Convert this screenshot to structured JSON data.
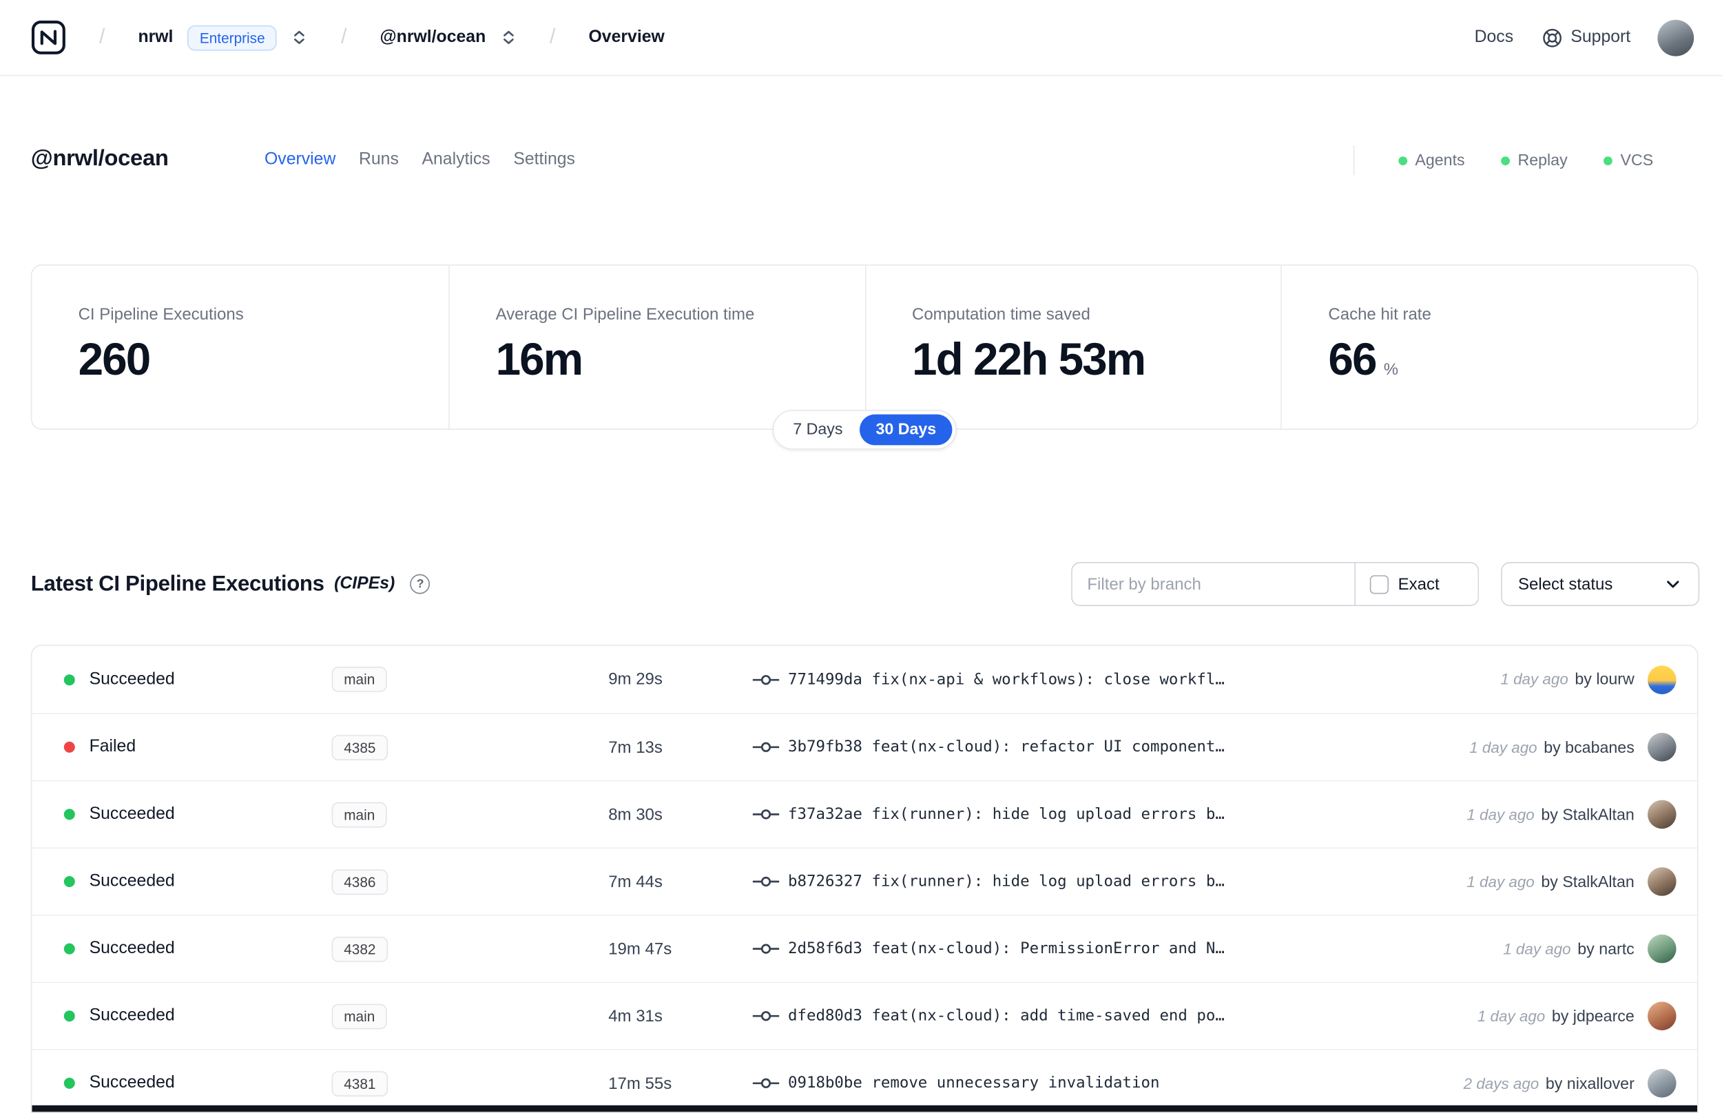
{
  "colors": {
    "accent": "#2563eb",
    "success": "#22c55e",
    "failed": "#ef4444",
    "indicator_green": "#4ade80"
  },
  "icons": {
    "help": "?"
  },
  "navbar": {
    "separator": "/",
    "org": "nrwl",
    "org_badge": "Enterprise",
    "workspace": "@nrwl/ocean",
    "page": "Overview",
    "docs": "Docs",
    "support": "Support"
  },
  "workspace": {
    "title": "@nrwl/ocean",
    "tabs": [
      "Overview",
      "Runs",
      "Analytics",
      "Settings"
    ],
    "indicators": [
      "Agents",
      "Replay",
      "VCS"
    ]
  },
  "stats": {
    "cards": [
      {
        "label": "CI Pipeline Executions",
        "value": "260"
      },
      {
        "label": "Average CI Pipeline Execution time",
        "value": "16m"
      },
      {
        "label": "Computation time saved",
        "value": "1d 22h 53m"
      },
      {
        "label": "Cache hit rate",
        "value": "66",
        "suffix": "%"
      }
    ],
    "range_toggle": {
      "options": [
        "7 Days",
        "30 Days"
      ],
      "selected": "30 Days"
    }
  },
  "cipe_section": {
    "title": "Latest CI Pipeline Executions",
    "subtitle": "(CIPEs)",
    "filter_placeholder": "Filter by branch",
    "exact_label": "Exact",
    "status_dropdown": "Select status"
  },
  "table": {
    "rows": [
      {
        "status": "Succeeded",
        "branch": "main",
        "duration": "9m 29s",
        "commit": "771499da fix(nx-api & workflows): close workfl…",
        "time": "1 day ago",
        "author": "by lourw"
      },
      {
        "status": "Failed",
        "branch": "4385",
        "duration": "7m 13s",
        "commit": "3b79fb38 feat(nx-cloud): refactor UI component…",
        "time": "1 day ago",
        "author": "by bcabanes"
      },
      {
        "status": "Succeeded",
        "branch": "main",
        "duration": "8m 30s",
        "commit": "f37a32ae fix(runner): hide log upload errors b…",
        "time": "1 day ago",
        "author": "by StalkAltan"
      },
      {
        "status": "Succeeded",
        "branch": "4386",
        "duration": "7m 44s",
        "commit": "b8726327 fix(runner): hide log upload errors b…",
        "time": "1 day ago",
        "author": "by StalkAltan"
      },
      {
        "status": "Succeeded",
        "branch": "4382",
        "duration": "19m 47s",
        "commit": "2d58f6d3 feat(nx-cloud): PermissionError and N…",
        "time": "1 day ago",
        "author": "by nartc"
      },
      {
        "status": "Succeeded",
        "branch": "main",
        "duration": "4m 31s",
        "commit": "dfed80d3 feat(nx-cloud): add time-saved end po…",
        "time": "1 day ago",
        "author": "by jdpearce"
      },
      {
        "status": "Succeeded",
        "branch": "4381",
        "duration": "17m 55s",
        "commit": "0918b0be remove unnecessary invalidation",
        "time": "2 days ago",
        "author": "by nixallover"
      }
    ]
  }
}
